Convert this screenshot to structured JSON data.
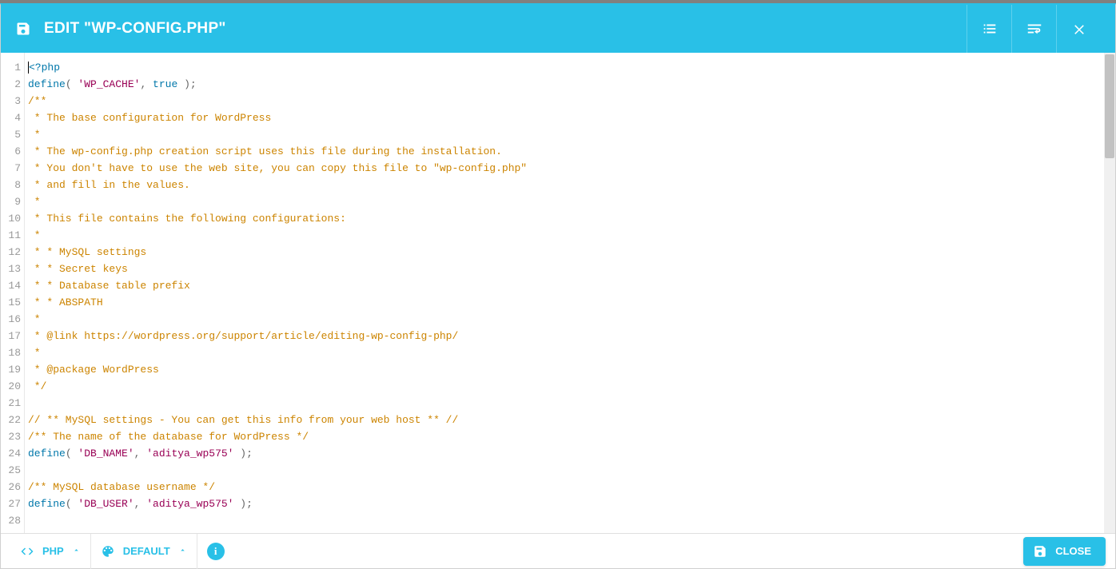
{
  "title": "EDIT \"WP-CONFIG.PHP\"",
  "icons": {
    "save": "save-icon",
    "list": "list-icon",
    "wrap": "wrap-icon",
    "close_x": "close-icon"
  },
  "footer": {
    "lang_label": "PHP",
    "theme_label": "DEFAULT",
    "close_label": "CLOSE"
  },
  "code": {
    "lines": [
      {
        "n": 1,
        "segments": [
          {
            "t": "<?php",
            "c": "kw"
          }
        ],
        "cursor_at": 0
      },
      {
        "n": 2,
        "segments": [
          {
            "t": "define",
            "c": "kw"
          },
          {
            "t": "( ",
            "c": "punc"
          },
          {
            "t": "'WP_CACHE'",
            "c": "str"
          },
          {
            "t": ", ",
            "c": "punc"
          },
          {
            "t": "true",
            "c": "bool"
          },
          {
            "t": " );",
            "c": "punc"
          }
        ]
      },
      {
        "n": 3,
        "segments": [
          {
            "t": "/**",
            "c": "cmt"
          }
        ]
      },
      {
        "n": 4,
        "segments": [
          {
            "t": " * The base configuration for WordPress",
            "c": "cmt"
          }
        ]
      },
      {
        "n": 5,
        "segments": [
          {
            "t": " *",
            "c": "cmt"
          }
        ]
      },
      {
        "n": 6,
        "segments": [
          {
            "t": " * The wp-config.php creation script uses this file during the installation.",
            "c": "cmt"
          }
        ]
      },
      {
        "n": 7,
        "segments": [
          {
            "t": " * You don't have to use the web site, you can copy this file to \"wp-config.php\"",
            "c": "cmt"
          }
        ]
      },
      {
        "n": 8,
        "segments": [
          {
            "t": " * and fill in the values.",
            "c": "cmt"
          }
        ]
      },
      {
        "n": 9,
        "segments": [
          {
            "t": " *",
            "c": "cmt"
          }
        ]
      },
      {
        "n": 10,
        "segments": [
          {
            "t": " * This file contains the following configurations:",
            "c": "cmt"
          }
        ]
      },
      {
        "n": 11,
        "segments": [
          {
            "t": " *",
            "c": "cmt"
          }
        ]
      },
      {
        "n": 12,
        "segments": [
          {
            "t": " * * MySQL settings",
            "c": "cmt"
          }
        ]
      },
      {
        "n": 13,
        "segments": [
          {
            "t": " * * Secret keys",
            "c": "cmt"
          }
        ]
      },
      {
        "n": 14,
        "segments": [
          {
            "t": " * * Database table prefix",
            "c": "cmt"
          }
        ]
      },
      {
        "n": 15,
        "segments": [
          {
            "t": " * * ABSPATH",
            "c": "cmt"
          }
        ]
      },
      {
        "n": 16,
        "segments": [
          {
            "t": " *",
            "c": "cmt"
          }
        ]
      },
      {
        "n": 17,
        "segments": [
          {
            "t": " * @link https://wordpress.org/support/article/editing-wp-config-php/",
            "c": "cmt"
          }
        ]
      },
      {
        "n": 18,
        "segments": [
          {
            "t": " *",
            "c": "cmt"
          }
        ]
      },
      {
        "n": 19,
        "segments": [
          {
            "t": " * @package WordPress",
            "c": "cmt"
          }
        ]
      },
      {
        "n": 20,
        "segments": [
          {
            "t": " */",
            "c": "cmt"
          }
        ]
      },
      {
        "n": 21,
        "segments": [
          {
            "t": "",
            "c": ""
          }
        ]
      },
      {
        "n": 22,
        "segments": [
          {
            "t": "// ** MySQL settings - You can get this info from your web host ** //",
            "c": "cmt"
          }
        ]
      },
      {
        "n": 23,
        "segments": [
          {
            "t": "/** The name of the database for WordPress */",
            "c": "cmt"
          }
        ]
      },
      {
        "n": 24,
        "segments": [
          {
            "t": "define",
            "c": "kw"
          },
          {
            "t": "( ",
            "c": "punc"
          },
          {
            "t": "'DB_NAME'",
            "c": "str"
          },
          {
            "t": ", ",
            "c": "punc"
          },
          {
            "t": "'aditya_wp575'",
            "c": "str"
          },
          {
            "t": " );",
            "c": "punc"
          }
        ]
      },
      {
        "n": 25,
        "segments": [
          {
            "t": "",
            "c": ""
          }
        ]
      },
      {
        "n": 26,
        "segments": [
          {
            "t": "/** MySQL database username */",
            "c": "cmt"
          }
        ]
      },
      {
        "n": 27,
        "segments": [
          {
            "t": "define",
            "c": "kw"
          },
          {
            "t": "( ",
            "c": "punc"
          },
          {
            "t": "'DB_USER'",
            "c": "str"
          },
          {
            "t": ", ",
            "c": "punc"
          },
          {
            "t": "'aditya_wp575'",
            "c": "str"
          },
          {
            "t": " );",
            "c": "punc"
          }
        ]
      },
      {
        "n": 28,
        "segments": [
          {
            "t": "",
            "c": ""
          }
        ]
      }
    ]
  }
}
